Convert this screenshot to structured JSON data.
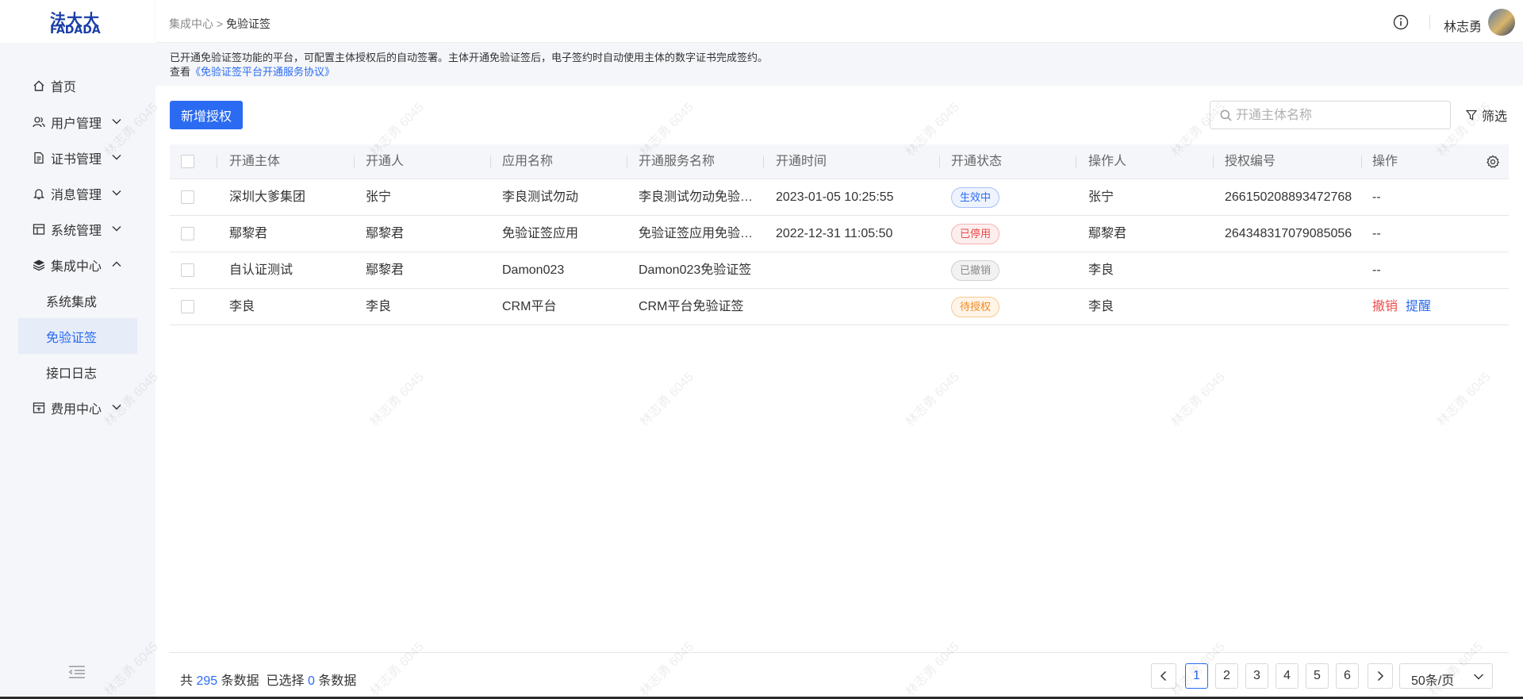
{
  "logo": {
    "top": "法大大",
    "bottom": "FADADA"
  },
  "header": {
    "breadcrumb_parent": "集成中心",
    "breadcrumb_sep": ">",
    "breadcrumb_current": "免验证签",
    "user_name": "林志勇"
  },
  "sidebar": {
    "items": [
      {
        "label": "首页",
        "icon": "home-icon"
      },
      {
        "label": "用户管理",
        "icon": "users-icon",
        "expanded": false
      },
      {
        "label": "证书管理",
        "icon": "certificate-icon",
        "expanded": false
      },
      {
        "label": "消息管理",
        "icon": "bell-icon",
        "expanded": false
      },
      {
        "label": "系统管理",
        "icon": "system-icon",
        "expanded": false
      },
      {
        "label": "集成中心",
        "icon": "layers-icon",
        "expanded": true
      },
      {
        "label": "费用中心",
        "icon": "billing-icon",
        "expanded": false
      }
    ],
    "sub_items": [
      {
        "label": "系统集成",
        "active": false
      },
      {
        "label": "免验证签",
        "active": true
      },
      {
        "label": "接口日志",
        "active": false
      }
    ]
  },
  "notice": {
    "line1": "已开通免验证签功能的平台，可配置主体授权后的自动签署。主体开通免验证签后，电子签约时自动使用主体的数字证书完成签约。",
    "line2_prefix": "查看",
    "line2_link": "《免验证签平台开通服务协议》"
  },
  "toolbar": {
    "add_button": "新增授权",
    "search_placeholder": "开通主体名称",
    "filter_label": "筛选"
  },
  "table": {
    "columns": [
      "开通主体",
      "开通人",
      "应用名称",
      "开通服务名称",
      "开通时间",
      "开通状态",
      "操作人",
      "授权编号",
      "操作"
    ],
    "rows": [
      {
        "subject": "深圳大爹集团",
        "opener": "张宁",
        "app": "李良测试勿动",
        "service": "李良测试勿动免验证签",
        "time": "2023-01-05 10:25:55",
        "status": "生效中",
        "status_type": "active",
        "operator": "张宁",
        "auth_no": "266150208893472768",
        "action": "--"
      },
      {
        "subject": "鄢黎君",
        "opener": "鄢黎君",
        "app": "免验证签应用",
        "service": "免验证签应用免验证签",
        "time": "2022-12-31 11:05:50",
        "status": "已停用",
        "status_type": "stopped",
        "operator": "鄢黎君",
        "auth_no": "264348317079085056",
        "action": "--"
      },
      {
        "subject": "自认证测试",
        "opener": "鄢黎君",
        "app": "Damon023",
        "service": "Damon023免验证签",
        "time": "",
        "status": "已撤销",
        "status_type": "revoked",
        "operator": "李良",
        "auth_no": "",
        "action": "--"
      },
      {
        "subject": "李良",
        "opener": "李良",
        "app": "CRM平台",
        "service": "CRM平台免验证签",
        "time": "",
        "status": "待授权",
        "status_type": "pending",
        "operator": "李良",
        "auth_no": "",
        "action_revoke": "撤销",
        "action_remind": "提醒"
      }
    ]
  },
  "footer": {
    "total_prefix": "共",
    "total_count": "295",
    "total_suffix": "条数据",
    "selected_prefix": "已选择",
    "selected_count": "0",
    "selected_suffix": "条数据",
    "pages": [
      "1",
      "2",
      "3",
      "4",
      "5",
      "6"
    ],
    "current_page": "1",
    "page_size": "50条/页"
  },
  "watermark": "林志勇 6045",
  "colors": {
    "primary": "#2a6bf2",
    "danger": "#ef4b4b",
    "warning": "#f08a24",
    "sidebar_bg": "#f5f6fa"
  }
}
